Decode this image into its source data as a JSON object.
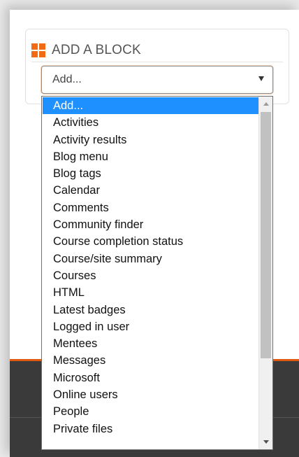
{
  "block": {
    "title": "ADD A BLOCK",
    "icon": "grid-icon",
    "accent_color": "#f26b12"
  },
  "select": {
    "value": "Add..."
  },
  "dropdown": {
    "selected_index": 0,
    "options": [
      "Add...",
      "Activities",
      "Activity results",
      "Blog menu",
      "Blog tags",
      "Calendar",
      "Comments",
      "Community finder",
      "Course completion status",
      "Course/site summary",
      "Courses",
      "HTML",
      "Latest badges",
      "Logged in user",
      "Mentees",
      "Messages",
      "Microsoft",
      "Online users",
      "People",
      "Private files"
    ],
    "highlight_color": "#1e90ff"
  }
}
